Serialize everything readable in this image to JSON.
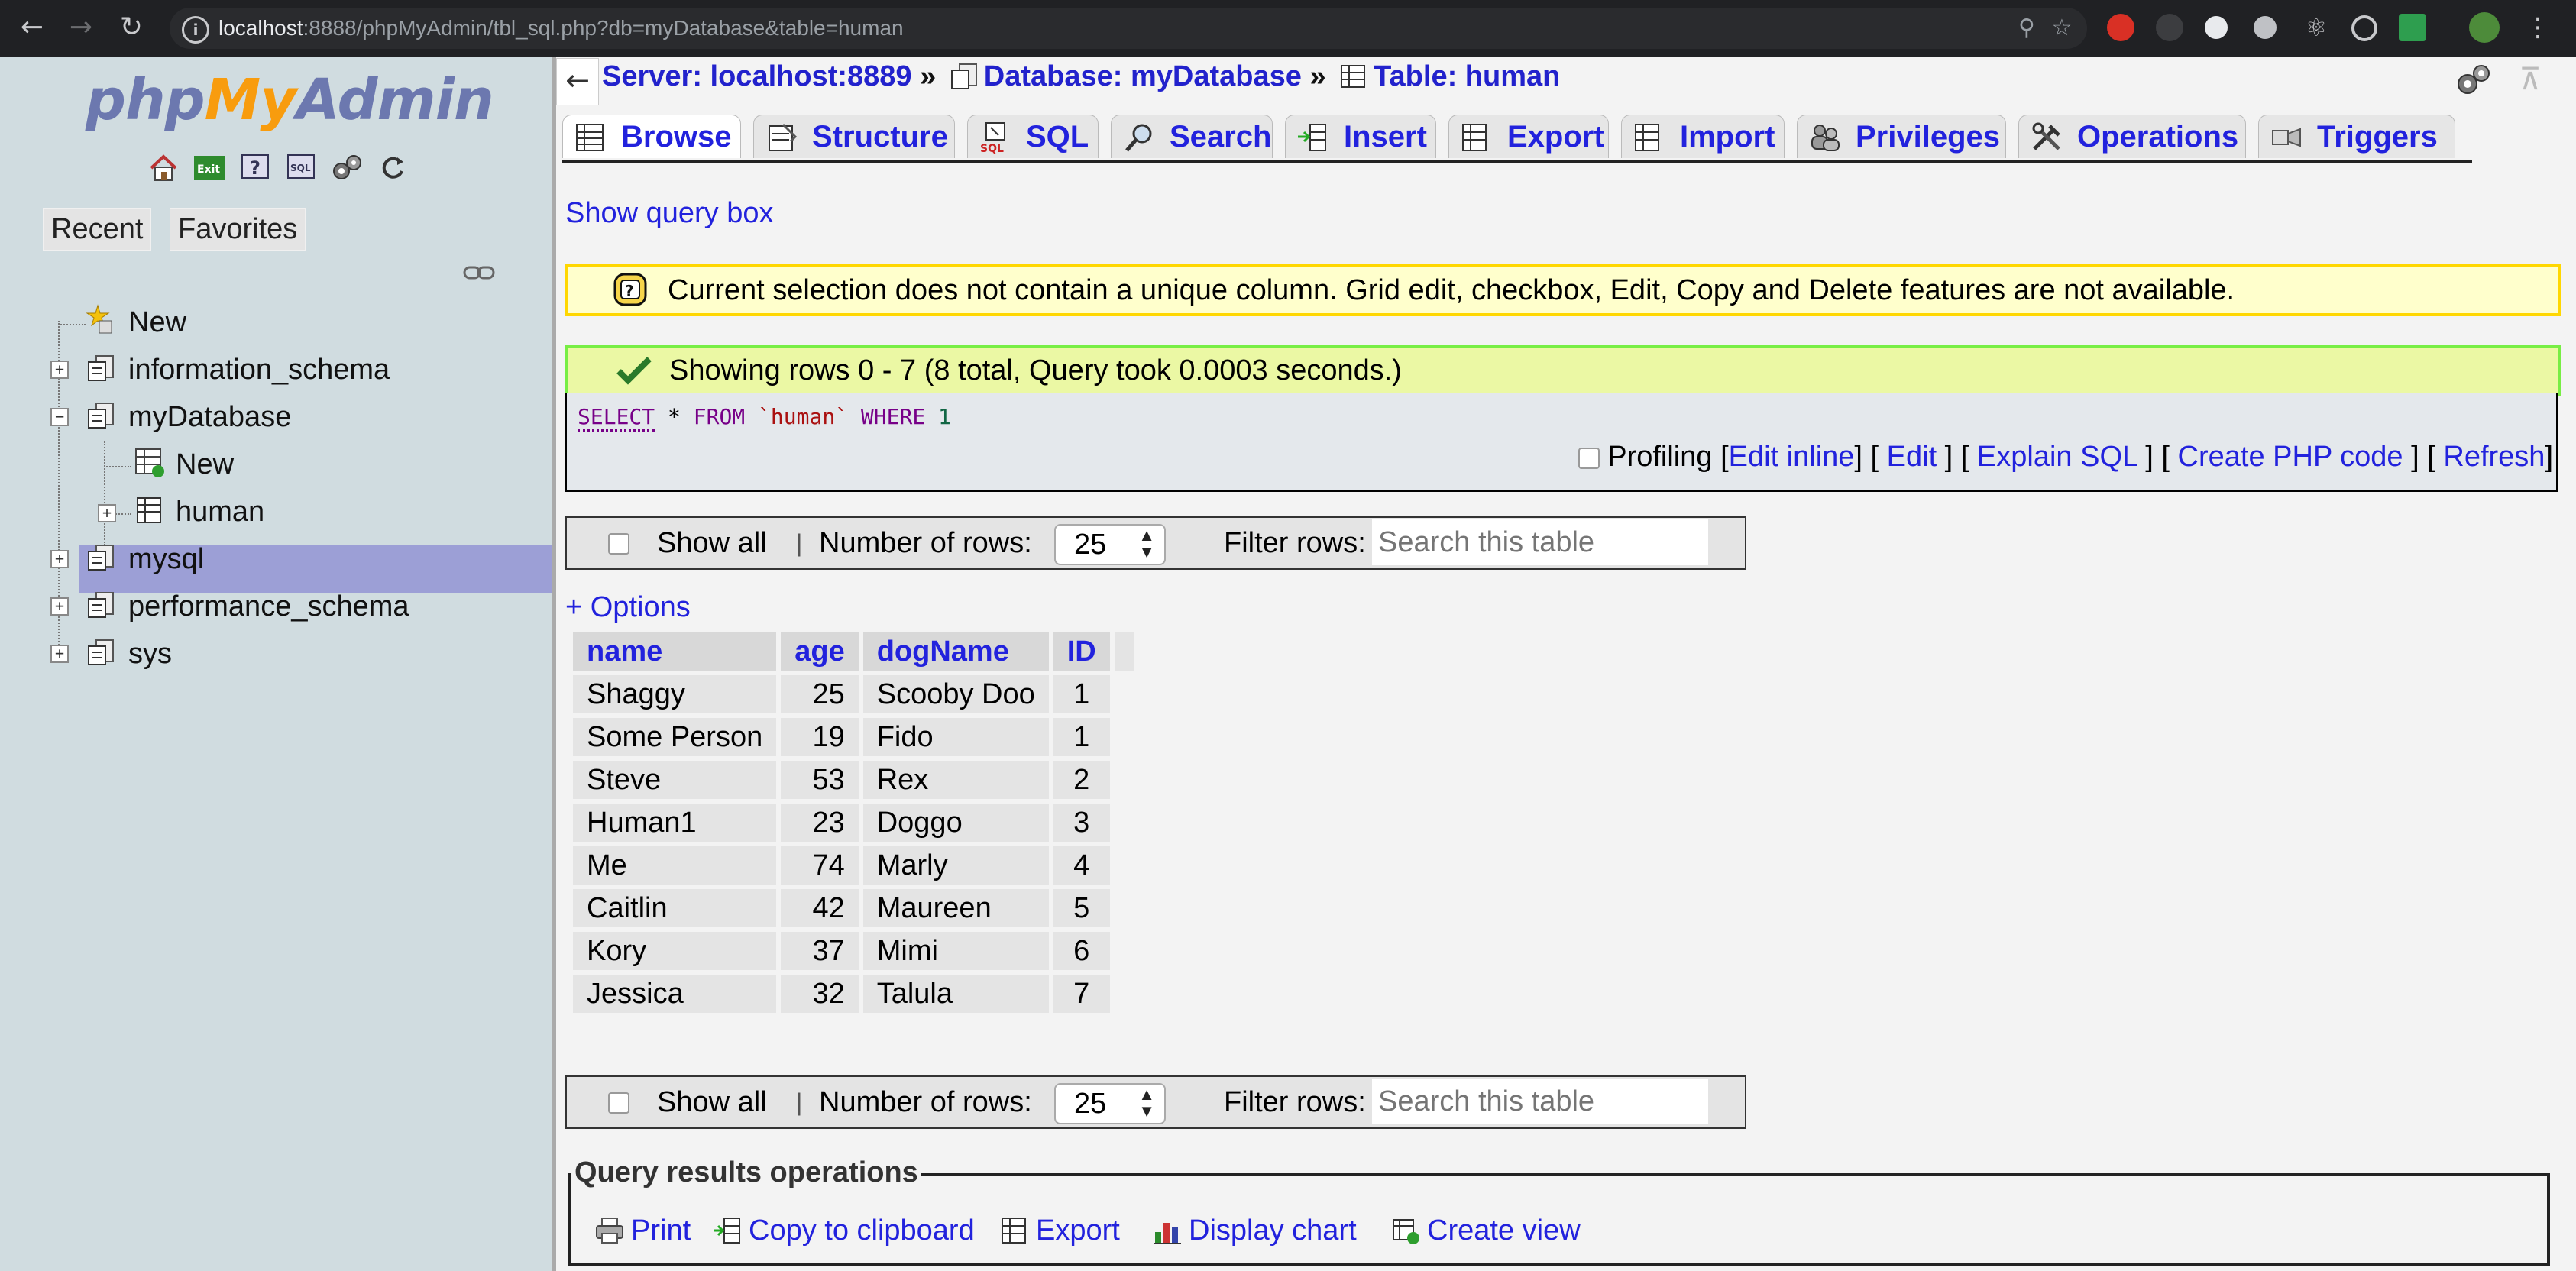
{
  "browser": {
    "url_host": "localhost",
    "url_rest": ":8888/phpMyAdmin/tbl_sql.php?db=myDatabase&table=human"
  },
  "sidebar": {
    "logo": {
      "php": "php",
      "my": "My",
      "admin": "Admin"
    },
    "tabs": {
      "recent": "Recent",
      "favorites": "Favorites"
    },
    "tree": {
      "new_root": "New",
      "information_schema": "information_schema",
      "myDatabase": "myDatabase",
      "new_table": "New",
      "human": "human",
      "mysql": "mysql",
      "performance_schema": "performance_schema",
      "sys": "sys"
    }
  },
  "breadcrumb": {
    "server": "Server: localhost:8889",
    "sep": "»",
    "database": "Database: myDatabase",
    "table": "Table: human"
  },
  "tabs": {
    "browse": "Browse",
    "structure": "Structure",
    "sql": "SQL",
    "search": "Search",
    "insert": "Insert",
    "export": "Export",
    "import": "Import",
    "privileges": "Privileges",
    "operations": "Operations",
    "triggers": "Triggers"
  },
  "main": {
    "show_query_box": "Show query box",
    "notice": "Current selection does not contain a unique column. Grid edit, checkbox, Edit, Copy and Delete features are not available.",
    "success": "Showing rows 0 - 7 (8 total, Query took 0.0003 seconds.)",
    "sql": {
      "select": "SELECT",
      "star": " * ",
      "from": "FROM",
      "table": " `human` ",
      "where": "WHERE",
      "one": " 1"
    },
    "sql_links": {
      "profiling": "Profiling",
      "edit_inline": "Edit inline",
      "edit": "Edit",
      "explain": "Explain SQL",
      "create_php": "Create PHP code",
      "refresh": "Refresh"
    },
    "navbar": {
      "show_all": "Show all",
      "number_of_rows": "Number of rows:",
      "rows_value": "25",
      "filter_rows": "Filter rows:",
      "filter_placeholder": "Search this table"
    },
    "options": "+ Options",
    "table": {
      "columns": [
        "name",
        "age",
        "dogName",
        "ID"
      ],
      "rows": [
        [
          "Shaggy",
          "25",
          "Scooby Doo",
          "1"
        ],
        [
          "Some Person",
          "19",
          "Fido",
          "1"
        ],
        [
          "Steve",
          "53",
          "Rex",
          "2"
        ],
        [
          "Human1",
          "23",
          "Doggo",
          "3"
        ],
        [
          "Me",
          "74",
          "Marly",
          "4"
        ],
        [
          "Caitlin",
          "42",
          "Maureen",
          "5"
        ],
        [
          "Kory",
          "37",
          "Mimi",
          "6"
        ],
        [
          "Jessica",
          "32",
          "Talula",
          "7"
        ]
      ]
    },
    "query_results_ops": {
      "title": "Query results operations",
      "print": "Print",
      "copy": "Copy to clipboard",
      "export": "Export",
      "display_chart": "Display chart",
      "create_view": "Create view"
    }
  },
  "colors": {
    "link": "#2222dd",
    "sidebar_bg": "#d0dce0",
    "selected_row": "#9c9fd6",
    "notice_bg": "#ffffcc",
    "success_bg": "#ebf8a4"
  }
}
